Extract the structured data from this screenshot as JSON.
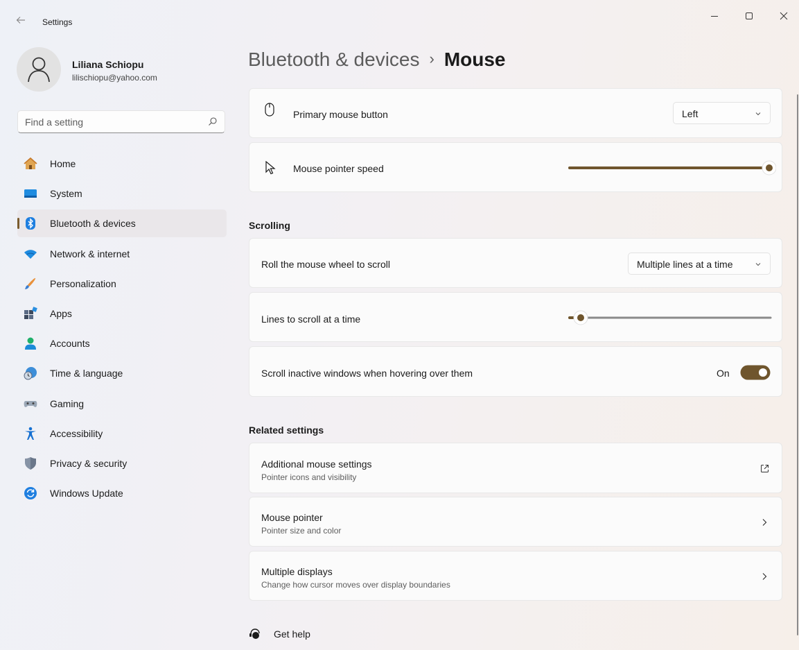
{
  "window": {
    "title": "Settings"
  },
  "user": {
    "name": "Liliana Schiopu",
    "email": "lilischiopu@yahoo.com"
  },
  "search": {
    "placeholder": "Find a setting"
  },
  "nav": {
    "items": [
      {
        "label": "Home",
        "icon": "home-icon"
      },
      {
        "label": "System",
        "icon": "system-icon"
      },
      {
        "label": "Bluetooth & devices",
        "icon": "bluetooth-icon",
        "selected": true
      },
      {
        "label": "Network & internet",
        "icon": "wifi-icon"
      },
      {
        "label": "Personalization",
        "icon": "brush-icon"
      },
      {
        "label": "Apps",
        "icon": "apps-icon"
      },
      {
        "label": "Accounts",
        "icon": "accounts-icon"
      },
      {
        "label": "Time & language",
        "icon": "globe-clock-icon"
      },
      {
        "label": "Gaming",
        "icon": "gamepad-icon"
      },
      {
        "label": "Accessibility",
        "icon": "accessibility-icon"
      },
      {
        "label": "Privacy & security",
        "icon": "shield-icon"
      },
      {
        "label": "Windows Update",
        "icon": "update-icon"
      }
    ]
  },
  "breadcrumb": {
    "parent": "Bluetooth & devices",
    "separator": "›",
    "current": "Mouse"
  },
  "mouse": {
    "primary_button": {
      "label": "Primary mouse button",
      "value": "Left"
    },
    "pointer_speed": {
      "label": "Mouse pointer speed",
      "level": 1.0
    }
  },
  "scrolling": {
    "header": "Scrolling",
    "roll_wheel": {
      "label": "Roll the mouse wheel to scroll",
      "value": "Multiple lines at a time"
    },
    "lines": {
      "label": "Lines to scroll at a time",
      "level": 0.0
    },
    "inactive": {
      "label": "Scroll inactive windows when hovering over them",
      "state": "On"
    }
  },
  "related": {
    "header": "Related settings",
    "items": [
      {
        "title": "Additional mouse settings",
        "subtitle": "Pointer icons and visibility",
        "icon": "external-link-icon"
      },
      {
        "title": "Mouse pointer",
        "subtitle": "Pointer size and color",
        "icon": "chevron-right-icon"
      },
      {
        "title": "Multiple displays",
        "subtitle": "Change how cursor moves over display boundaries",
        "icon": "chevron-right-icon"
      }
    ]
  },
  "help": {
    "label": "Get help"
  },
  "colors": {
    "accent": "#6f552d",
    "track_off": "#8a8a8a"
  }
}
